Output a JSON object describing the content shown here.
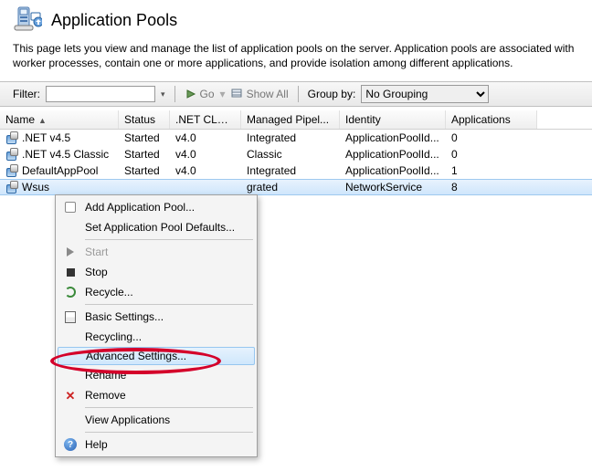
{
  "header": {
    "title": "Application Pools",
    "description": "This page lets you view and manage the list of application pools on the server. Application pools are associated with worker processes, contain one or more applications, and provide isolation among different applications."
  },
  "toolbar": {
    "filter_label": "Filter:",
    "filter_value": "",
    "go_label": "Go",
    "showall_label": "Show All",
    "groupby_label": "Group by:",
    "group_options": [
      "No Grouping"
    ],
    "group_selected": "No Grouping"
  },
  "columns": {
    "name": "Name",
    "status": "Status",
    "clr": ".NET CLR V...",
    "pipeline": "Managed Pipel...",
    "identity": "Identity",
    "apps": "Applications",
    "sort_indicator": "▲"
  },
  "rows": [
    {
      "name": ".NET v4.5",
      "status": "Started",
      "clr": "v4.0",
      "pipeline": "Integrated",
      "identity": "ApplicationPoolId...",
      "apps": "0",
      "selected": false
    },
    {
      "name": ".NET v4.5 Classic",
      "status": "Started",
      "clr": "v4.0",
      "pipeline": "Classic",
      "identity": "ApplicationPoolId...",
      "apps": "0",
      "selected": false
    },
    {
      "name": "DefaultAppPool",
      "status": "Started",
      "clr": "v4.0",
      "pipeline": "Integrated",
      "identity": "ApplicationPoolId...",
      "apps": "1",
      "selected": false
    },
    {
      "name": "Wsus",
      "status": "",
      "clr": "",
      "pipeline": "grated",
      "identity": "NetworkService",
      "apps": "8",
      "selected": true
    }
  ],
  "contextmenu": {
    "items": [
      {
        "id": "add",
        "label": "Add Application Pool...",
        "enabled": true,
        "icon": "ci-add"
      },
      {
        "id": "defaults",
        "label": "Set Application Pool Defaults...",
        "enabled": true,
        "icon": ""
      },
      {
        "sep": true
      },
      {
        "id": "start",
        "label": "Start",
        "enabled": false,
        "icon": "ci-start"
      },
      {
        "id": "stop",
        "label": "Stop",
        "enabled": true,
        "icon": "ci-stop"
      },
      {
        "id": "recycle",
        "label": "Recycle...",
        "enabled": true,
        "icon": "ci-recycle"
      },
      {
        "sep": true
      },
      {
        "id": "basic",
        "label": "Basic Settings...",
        "enabled": true,
        "icon": "ci-basic"
      },
      {
        "id": "recycling",
        "label": "Recycling...",
        "enabled": true,
        "icon": ""
      },
      {
        "id": "advanced",
        "label": "Advanced Settings...",
        "enabled": true,
        "icon": "",
        "hovered": true
      },
      {
        "id": "rename",
        "label": "Rename",
        "enabled": true,
        "icon": ""
      },
      {
        "id": "remove",
        "label": "Remove",
        "enabled": true,
        "icon": "ci-remove"
      },
      {
        "sep": true
      },
      {
        "id": "viewapps",
        "label": "View Applications",
        "enabled": true,
        "icon": ""
      },
      {
        "sep": true
      },
      {
        "id": "help",
        "label": "Help",
        "enabled": true,
        "icon": "ci-help"
      }
    ]
  }
}
